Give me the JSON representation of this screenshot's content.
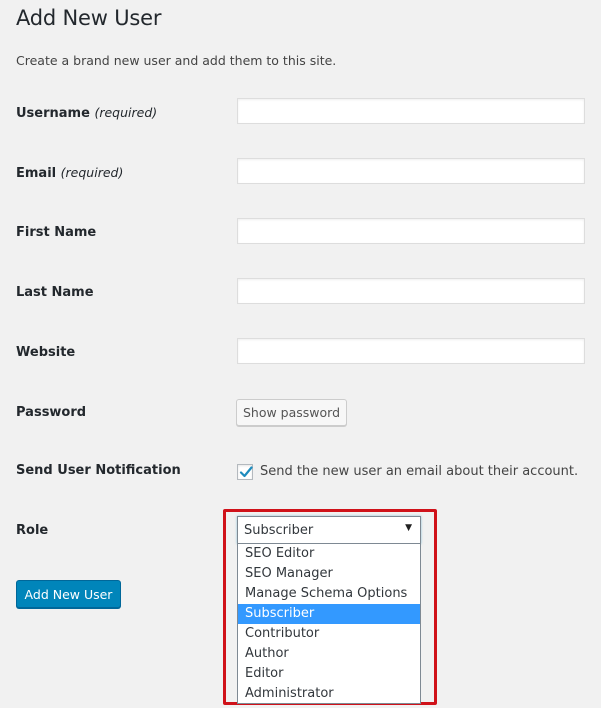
{
  "header": {
    "title": "Add New User",
    "description": "Create a brand new user and add them to this site."
  },
  "fields": {
    "username": {
      "label": "Username",
      "required_note": "(required)",
      "value": ""
    },
    "email": {
      "label": "Email",
      "required_note": "(required)",
      "value": ""
    },
    "first_name": {
      "label": "First Name",
      "value": ""
    },
    "last_name": {
      "label": "Last Name",
      "value": ""
    },
    "website": {
      "label": "Website",
      "value": ""
    },
    "password": {
      "label": "Password",
      "show_button_label": "Show password"
    },
    "notification": {
      "label": "Send User Notification",
      "checkbox_label": "Send the new user an email about their account.",
      "checked": true
    },
    "role": {
      "label": "Role",
      "selected": "Subscriber",
      "arrow_icon": "▼",
      "options": [
        "SEO Editor",
        "SEO Manager",
        "Manage Schema Options",
        "Subscriber",
        "Contributor",
        "Author",
        "Editor",
        "Administrator"
      ],
      "highlighted_index": 3
    }
  },
  "submit": {
    "label": "Add New User"
  },
  "colors": {
    "primary_button": "#0085ba",
    "selected_option": "#3399ff",
    "highlight_border": "#d0121a",
    "checkmark": "#1e8cbe"
  }
}
